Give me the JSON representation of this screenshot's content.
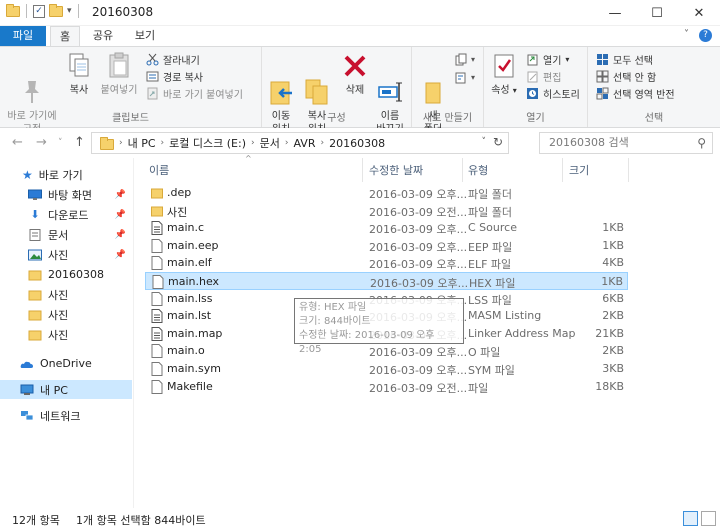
{
  "window": {
    "title": "20160308",
    "controls": {
      "minimize": "—",
      "maximize": "☐",
      "close": "✕"
    }
  },
  "ribbon_tabs": [
    "파일",
    "홈",
    "공유",
    "보기"
  ],
  "ribbon_controls": {
    "collapse": "˅",
    "help": "?"
  },
  "ribbon": {
    "clipboard": {
      "label": "클립보드",
      "pin": "바로 가기에\n고정",
      "copy": "복사",
      "paste": "붙여넣기",
      "cut": "잘라내기",
      "copy_path": "경로 복사",
      "paste_shortcut": "바로 가기 붙여넣기"
    },
    "organize": {
      "label": "구성",
      "move_to": "이동\n위치",
      "copy_to": "복사\n위치",
      "delete": "삭제",
      "rename": "이름\n바꾸기"
    },
    "new": {
      "label": "새로 만들기",
      "new_folder": "새\n폴더"
    },
    "open": {
      "label": "열기",
      "properties": "속성",
      "open": "열기",
      "edit": "편집",
      "history": "히스토리"
    },
    "select": {
      "label": "선택",
      "select_all": "모두 선택",
      "select_none": "선택 안 함",
      "invert": "선택 영역 반전"
    }
  },
  "address": {
    "segments": [
      "내 PC",
      "로컬 디스크 (E:)",
      "문서",
      "AVR",
      "20160308"
    ],
    "search_placeholder": "20160308 검색"
  },
  "nav": {
    "quick_access": "바로 가기",
    "items": [
      {
        "label": "바탕 화면",
        "pinned": true
      },
      {
        "label": "다운로드",
        "pinned": true
      },
      {
        "label": "문서",
        "pinned": true
      },
      {
        "label": "사진",
        "pinned": true
      },
      {
        "label": "20160308",
        "pinned": false
      },
      {
        "label": "사진",
        "pinned": false
      },
      {
        "label": "사진",
        "pinned": false
      },
      {
        "label": "사진",
        "pinned": false
      }
    ],
    "onedrive": "OneDrive",
    "this_pc": "내 PC",
    "network": "네트워크"
  },
  "columns": {
    "name": "이름",
    "date": "수정한 날짜",
    "type": "유형",
    "size": "크기"
  },
  "files": [
    {
      "name": ".dep",
      "date": "2016-03-09 오후...",
      "type": "파일 폴더",
      "size": "",
      "kind": "folder"
    },
    {
      "name": "사진",
      "date": "2016-03-09 오전...",
      "type": "파일 폴더",
      "size": "",
      "kind": "folder"
    },
    {
      "name": "main.c",
      "date": "2016-03-09 오후...",
      "type": "C Source",
      "size": "1KB",
      "kind": "code"
    },
    {
      "name": "main.eep",
      "date": "2016-03-09 오후...",
      "type": "EEP 파일",
      "size": "1KB",
      "kind": "file"
    },
    {
      "name": "main.elf",
      "date": "2016-03-09 오후...",
      "type": "ELF 파일",
      "size": "4KB",
      "kind": "file"
    },
    {
      "name": "main.hex",
      "date": "2016-03-09 오후...",
      "type": "HEX 파일",
      "size": "1KB",
      "kind": "file",
      "selected": true
    },
    {
      "name": "main.lss",
      "date": "2016-03-09 오후...",
      "type": "LSS 파일",
      "size": "6KB",
      "kind": "file"
    },
    {
      "name": "main.lst",
      "date": "2016-03-09 오후...",
      "type": "MASM Listing",
      "size": "2KB",
      "kind": "code"
    },
    {
      "name": "main.map",
      "date": "2016-03-09 오후...",
      "type": "Linker Address Map",
      "size": "21KB",
      "kind": "code"
    },
    {
      "name": "main.o",
      "date": "2016-03-09 오후...",
      "type": "O 파일",
      "size": "2KB",
      "kind": "file"
    },
    {
      "name": "main.sym",
      "date": "2016-03-09 오후...",
      "type": "SYM 파일",
      "size": "3KB",
      "kind": "file"
    },
    {
      "name": "Makefile",
      "date": "2016-03-09 오전...",
      "type": "파일",
      "size": "18KB",
      "kind": "file"
    }
  ],
  "tooltip": {
    "line1": "유형: HEX 파일",
    "line2": "크기: 844바이트",
    "line3": "수정한 날짜: 2016-03-09 오후 2:05"
  },
  "status": {
    "item_count": "12개 항목",
    "selection": "1개 항목 선택함 844바이트"
  },
  "colors": {
    "accent": "#1979ca",
    "selection": "#cce8ff",
    "selection_border": "#99d1ff",
    "folder": "#f6d16b"
  },
  "icons": [
    "folder-icon",
    "pin-icon",
    "copy-icon",
    "paste-icon",
    "cut-icon",
    "delete-icon",
    "rename-icon",
    "properties-icon",
    "history-icon",
    "file-icon",
    "onedrive-icon",
    "pc-icon",
    "network-icon",
    "search-icon",
    "refresh-icon"
  ]
}
